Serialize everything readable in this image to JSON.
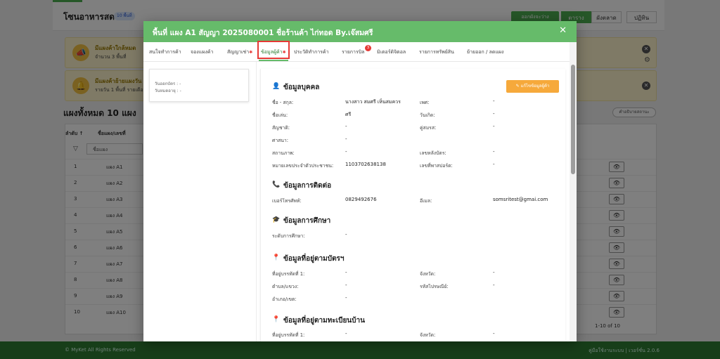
{
  "background": {
    "page_title": "โซนอาหารสด",
    "chip": "10 พื้นที่",
    "action_button": "ออกผังจะว่าง",
    "views": [
      "ตาราง",
      "ผังตลาด",
      "ปฏิทิน"
    ],
    "alert1": {
      "title": "มีแผงค้าใกล้หมด",
      "text": "จำนวน 3 พื้นที่"
    },
    "alert2": {
      "title": "มีแผงค้าย้ายแผงวัน",
      "text": "รายวัน 1 พื้นที่  รายเดือ"
    },
    "section_title": "แผงทั้งหมด 10 แผง",
    "right_link": "คำอธิบายสถานะ",
    "table_headers": [
      "ลำดับ ↑",
      "ชื่อแผง/เลขที่"
    ],
    "filter_placeholder": "ชื่อแผง",
    "rows": [
      {
        "no": "1",
        "name": "แผง A1"
      },
      {
        "no": "2",
        "name": "แผง A2"
      },
      {
        "no": "3",
        "name": "แผง A3"
      },
      {
        "no": "4",
        "name": "แผง A4"
      },
      {
        "no": "5",
        "name": "แผง A5"
      },
      {
        "no": "6",
        "name": "แผง A6"
      },
      {
        "no": "7",
        "name": "แผง A7"
      },
      {
        "no": "8",
        "name": "แผง A8"
      },
      {
        "no": "9",
        "name": "แผง A9"
      },
      {
        "no": "10",
        "name": "แผง A10"
      }
    ],
    "pager": "1-10 of 10",
    "footer_left": "© MyKet All Rights Reserved",
    "footer_right": "คู่มือใช้งานระบบ | เวอร์ชั่น 2.0.6"
  },
  "modal": {
    "title": "พื้นที่ แผง A1 สัญญา 2025080001 ชื่อร้านค้า ไก่ทอด By.เจ๊สมศรี",
    "tabs": [
      "สนใจทำการค้า",
      "จองแผงค้า",
      "สัญญาเช่า",
      "ข้อมูลผู้ค้า",
      "ประวัติทำการค้า",
      "รายการบิล",
      "มิเตอร์ดิจิตอล",
      "รายการทรัพย์สิน",
      "ย้ายออก / ลดแผง"
    ],
    "tab_badge": "3",
    "side": {
      "line1": "วันออกบัตร : -",
      "line2": "วันหมดอายุ : -"
    },
    "edit_button": "แก้ไขข้อมูลผู้ค้า",
    "personal": {
      "title": "ข้อมูลบุคคล",
      "fields": [
        {
          "label": "ชื่อ - สกุล:",
          "value": "นางสาว สมศรี เห็นสมควร"
        },
        {
          "label": "เพศ:",
          "value": "-"
        },
        {
          "label": "ชื่อเล่น:",
          "value": "ศรี"
        },
        {
          "label": "วันเกิด:",
          "value": "-"
        },
        {
          "label": "สัญชาติ:",
          "value": "-"
        },
        {
          "label": "คู่สมรส:",
          "value": "-"
        },
        {
          "label": "ศาสนา:",
          "value": "-"
        },
        {
          "label": "สถานภาพ:",
          "value": "-"
        },
        {
          "label": "เลขหลังบัตร:",
          "value": "-"
        },
        {
          "label": "หมายเลขประจำตัวประชาชน:",
          "value": "1103702638138"
        },
        {
          "label": "เลขที่พาสปอร์ต:",
          "value": "-"
        }
      ]
    },
    "contact": {
      "title": "ข้อมูลการติดต่อ",
      "phone_label": "เบอร์โทรศัพท์:",
      "phone": "0829492676",
      "email_label": "อีเมล:",
      "email": "somsritest@gmai.com"
    },
    "education": {
      "title": "ข้อมูลการศึกษา",
      "label": "ระดับการศึกษา:",
      "value": "-"
    },
    "address_card": {
      "title": "ข้อมูลที่อยู่ตามบัตรฯ",
      "fields": [
        {
          "label": "ที่อยู่บรรทัดที่ 1:",
          "value": "-"
        },
        {
          "label": "จังหวัด:",
          "value": "-"
        },
        {
          "label": "ตำบล/แขวง:",
          "value": "-"
        },
        {
          "label": "รหัสไปรษณีย์:",
          "value": "-"
        },
        {
          "label": "อำเภอ/เขต:",
          "value": "-"
        }
      ]
    },
    "address_house": {
      "title": "ข้อมูลที่อยู่ตามทะเบียนบ้าน",
      "fields": [
        {
          "label": "ที่อยู่บรรทัดที่ 1:",
          "value": "-"
        },
        {
          "label": "จังหวัด:",
          "value": "-"
        }
      ]
    }
  },
  "colors": {
    "primary": "#66bb6a",
    "accent": "#f6a93b",
    "highlight": "#e53935"
  }
}
